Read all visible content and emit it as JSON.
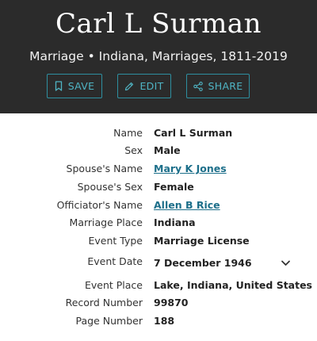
{
  "header": {
    "title": "Carl L Surman",
    "subtitle": "Marriage • Indiana, Marriages, 1811-2019",
    "buttons": {
      "save": "SAVE",
      "edit": "EDIT",
      "share": "SHARE"
    },
    "background": "#2b2b2b",
    "accent": "#4fb4c4"
  },
  "icons": {
    "save": "bookmark-icon",
    "edit": "pencil-icon",
    "share": "share-icon",
    "expand": "chevron-down-icon"
  },
  "details": {
    "name": {
      "label": "Name",
      "value": "Carl L Surman"
    },
    "sex": {
      "label": "Sex",
      "value": "Male"
    },
    "spouse_name": {
      "label": "Spouse's Name",
      "value": "Mary K Jones"
    },
    "spouse_sex": {
      "label": "Spouse's Sex",
      "value": "Female"
    },
    "officiator_name": {
      "label": "Officiator's Name",
      "value": "Allen B Rice"
    },
    "marriage_place": {
      "label": "Marriage Place",
      "value": "Indiana"
    },
    "event_type": {
      "label": "Event Type",
      "value": "Marriage License"
    },
    "event_date": {
      "label": "Event Date",
      "value": "7 December 1946"
    },
    "event_place": {
      "label": "Event Place",
      "value": "Lake, Indiana, United States"
    },
    "record_number": {
      "label": "Record Number",
      "value": "99870"
    },
    "page_number": {
      "label": "Page Number",
      "value": "188"
    }
  }
}
